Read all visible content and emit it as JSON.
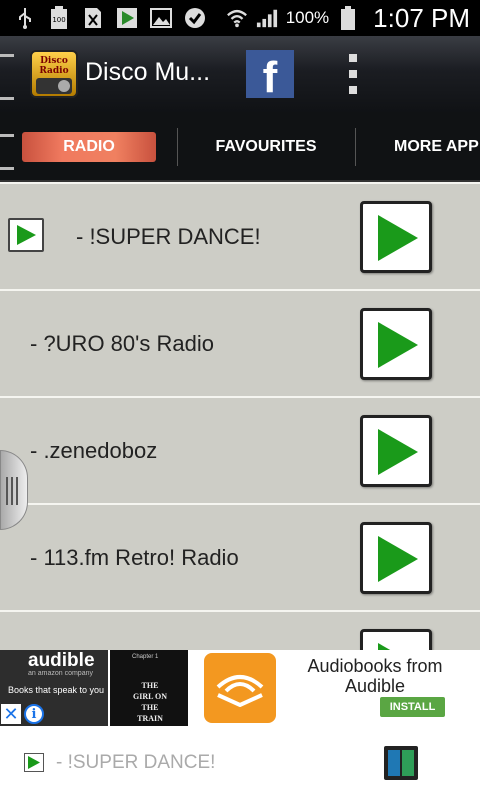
{
  "status_bar": {
    "battery_percent": "100%",
    "time": "1:07 PM",
    "icons": [
      "usb-icon",
      "battery-100-icon",
      "sim-icon",
      "play-store-icon",
      "image-icon",
      "check-icon",
      "wifi-icon",
      "signal-icon",
      "battery-icon"
    ]
  },
  "app_bar": {
    "app_icon_text": "Disco Radio",
    "title": "Disco Mu...",
    "facebook_label": "f"
  },
  "tabs": [
    {
      "label": "RADIO",
      "selected": true
    },
    {
      "label": "FAVOURITES",
      "selected": false
    },
    {
      "label": "MORE APP",
      "selected": false
    }
  ],
  "stations": [
    {
      "name": "- !SUPER DANCE!",
      "now_playing": true
    },
    {
      "name": "- ?URO 80's Radio",
      "now_playing": false
    },
    {
      "name": "- .zenedoboz",
      "now_playing": false
    },
    {
      "name": "- 113.fm Retro! Radio",
      "now_playing": false
    },
    {
      "name": "",
      "now_playing": false
    }
  ],
  "ad": {
    "brand": "audible",
    "brand_sub": "an amazon company",
    "tagline": "Books that speak to you",
    "book_chapter": "Chapter 1",
    "book_title": "THE GIRL ON THE TRAIN",
    "title": "Audiobooks from Audible",
    "install_label": "INSTALL",
    "close_label": "✕",
    "info_label": "i",
    "colors": {
      "logo": "#f39820",
      "install": "#5aa643",
      "info": "#1a73e8"
    }
  },
  "player": {
    "title": "- !SUPER DANCE!",
    "state": "playing"
  },
  "colors": {
    "accent_tab": "#f07a5f",
    "list_bg": "#cdcdc6",
    "play_green": "#1a9a1a"
  }
}
